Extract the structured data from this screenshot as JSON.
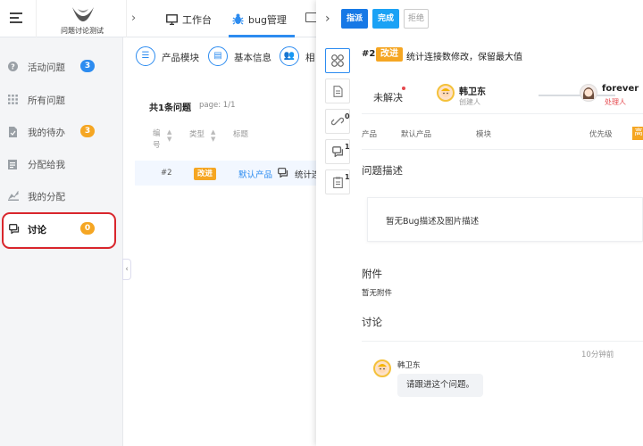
{
  "app": {
    "logo_text": "问题讨论测试"
  },
  "topnav": {
    "items": [
      {
        "label": "工作台",
        "icon": "monitor-icon"
      },
      {
        "label": "bug管理",
        "icon": "bug-icon"
      }
    ]
  },
  "sidebar": {
    "items": [
      {
        "label": "活动问题",
        "icon": "question-icon",
        "badge": "3",
        "badge_color": "#2d8cf0"
      },
      {
        "label": "所有问题",
        "icon": "grid-icon",
        "badge": null
      },
      {
        "label": "我的待办",
        "icon": "todo-icon",
        "badge": "3",
        "badge_color": "#f5a623"
      },
      {
        "label": "分配给我",
        "icon": "clipboard-icon",
        "badge": null
      },
      {
        "label": "我的分配",
        "icon": "assign-icon",
        "badge": null
      },
      {
        "label": "讨论",
        "icon": "chat-icon",
        "badge": "0",
        "badge_color": "#f5a623"
      }
    ]
  },
  "middle": {
    "tabs": [
      {
        "label": "产品模块",
        "icon": "list-icon"
      },
      {
        "label": "基本信息",
        "icon": "document-icon"
      },
      {
        "label": "相",
        "icon": "users-icon"
      }
    ],
    "card": {
      "title": "共1条问题",
      "page": "page:  1/1",
      "headers": [
        "编号",
        "类型",
        "标题"
      ],
      "row": {
        "id": "#2",
        "type": "改进",
        "product": "默认产品",
        "title": "统计连"
      }
    }
  },
  "panel": {
    "buttons": {
      "assign": "指派",
      "done": "完成",
      "reject": "拒绝"
    },
    "side_icons": [
      {
        "icon": "modules-icon",
        "count": null
      },
      {
        "icon": "document-icon",
        "count": null
      },
      {
        "icon": "link-icon",
        "count": "0"
      },
      {
        "icon": "chat-icon",
        "count": "1"
      },
      {
        "icon": "clipboard-icon",
        "count": "1"
      }
    ],
    "issue": {
      "id": "#2",
      "type": "改进",
      "title": "统计连接数修改，保留最大值"
    },
    "status": "未解决",
    "creator": {
      "name": "韩卫东",
      "role": "创建人"
    },
    "handler": {
      "name": "forever",
      "role": "处理人"
    },
    "meta": {
      "product_label": "产品",
      "product_value": "默认产品",
      "module_label": "模块",
      "priority_label": "优先级",
      "priority_value": "高"
    },
    "description": {
      "heading": "问题描述",
      "empty": "暂无Bug描述及图片描述"
    },
    "attachments": {
      "heading": "附件",
      "empty": "暂无附件"
    },
    "discussion": {
      "heading": "讨论",
      "time": "10分钟前",
      "author": "韩卫东",
      "text": "请跟进这个问题。"
    }
  },
  "colors": {
    "accent": "#2d8cf0",
    "highlight": "#d9262c",
    "tag": "#f5a623"
  }
}
